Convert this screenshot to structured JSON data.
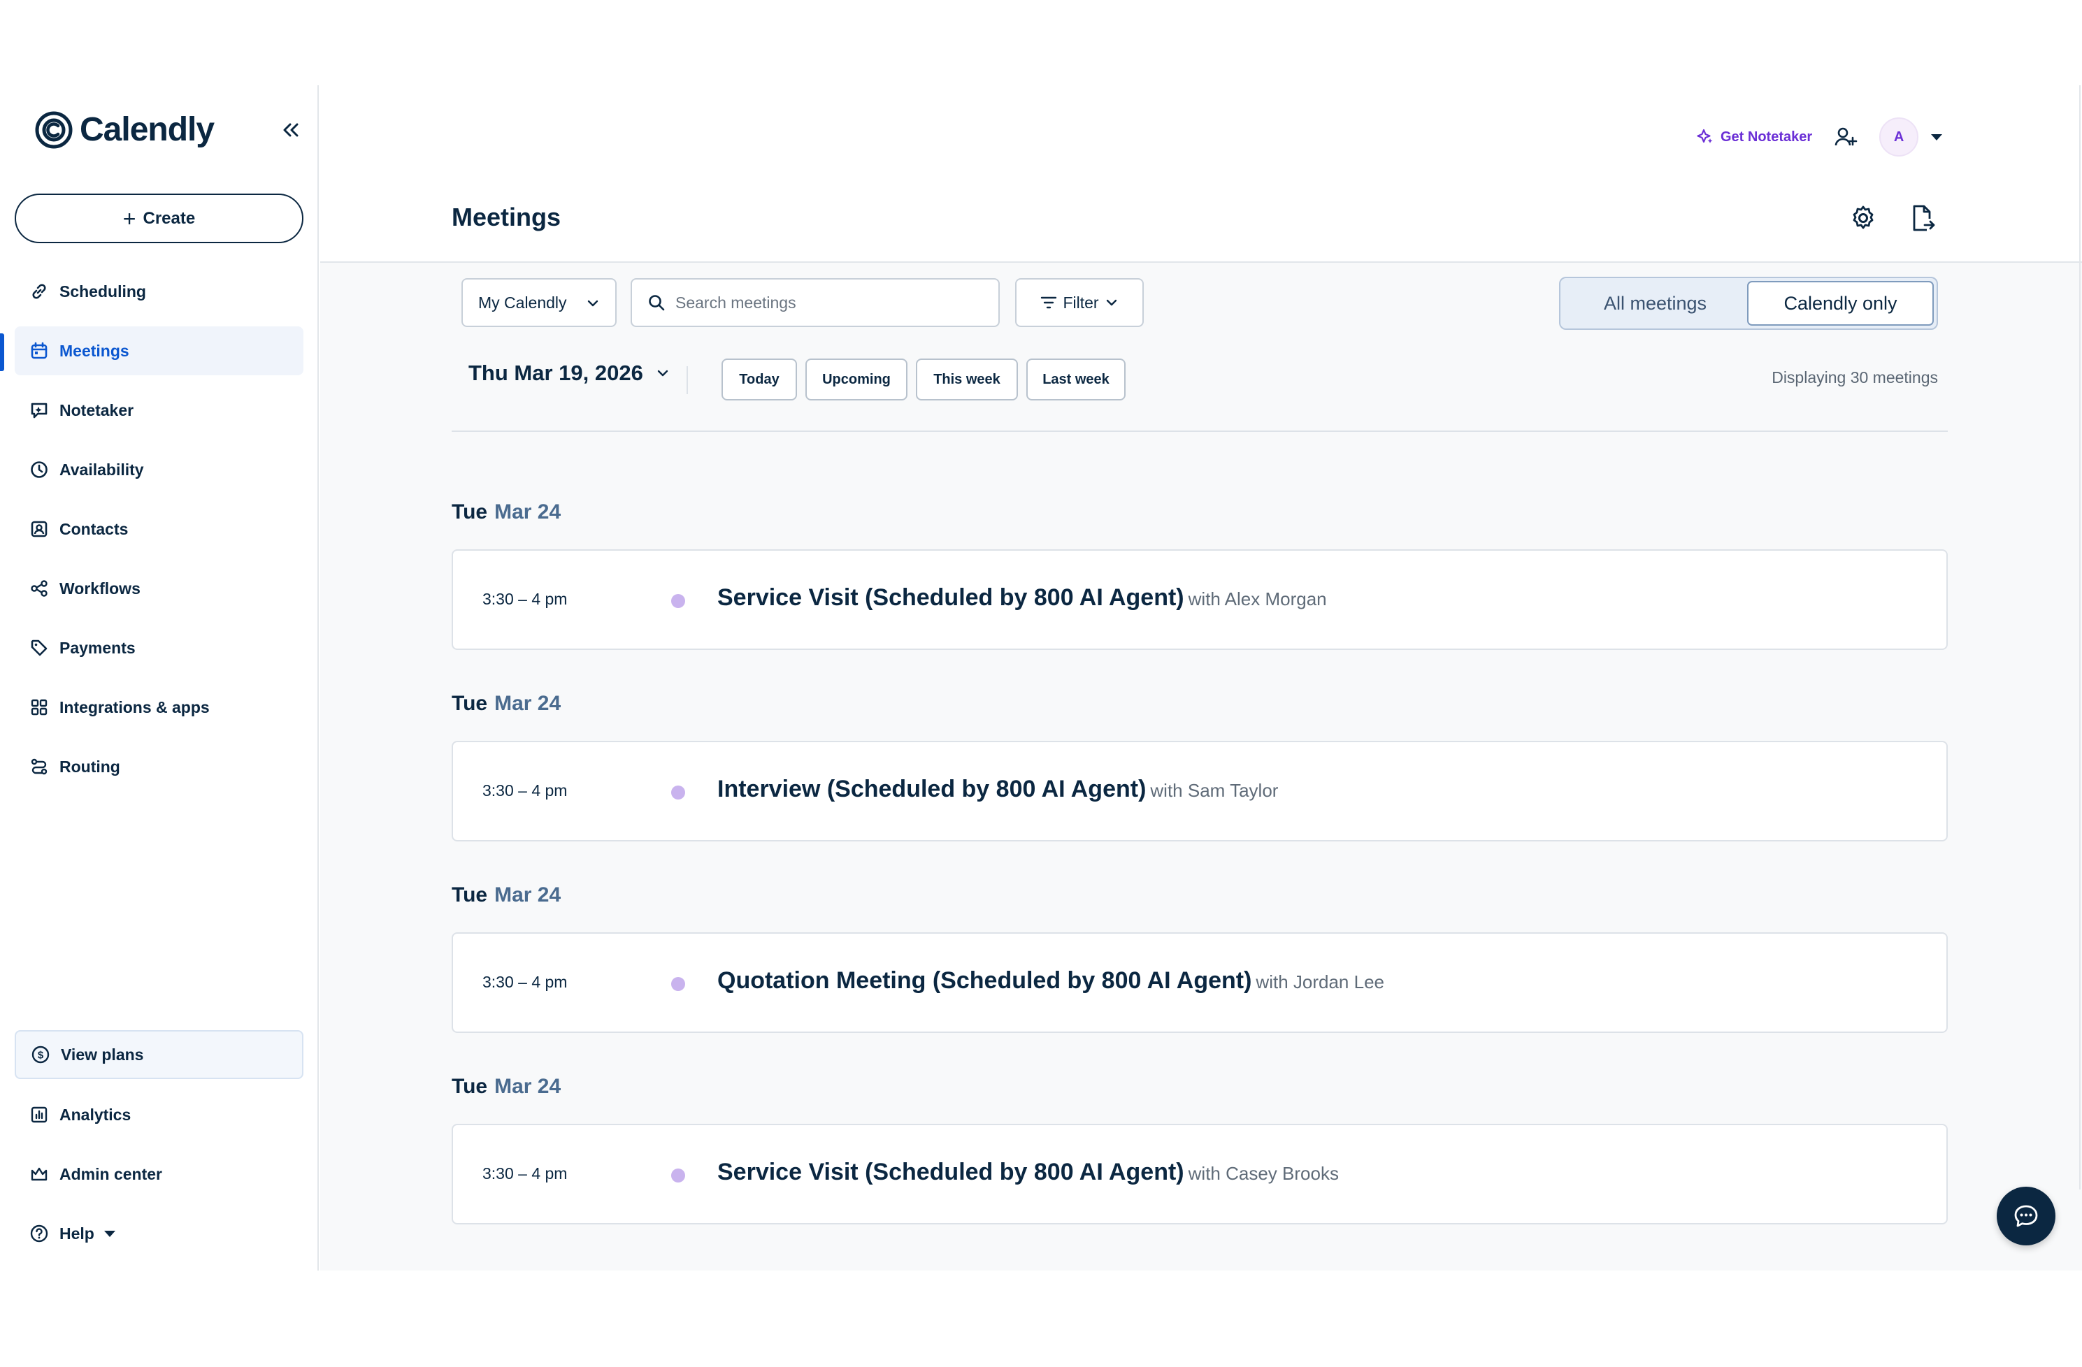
{
  "brand": {
    "name": "Calendly"
  },
  "sidebar": {
    "create_label": "Create",
    "items": [
      {
        "label": "Scheduling",
        "icon": "link-icon"
      },
      {
        "label": "Meetings",
        "icon": "calendar-icon"
      },
      {
        "label": "Notetaker",
        "icon": "notetaker-icon"
      },
      {
        "label": "Availability",
        "icon": "clock-icon"
      },
      {
        "label": "Contacts",
        "icon": "contact-card-icon"
      },
      {
        "label": "Workflows",
        "icon": "workflow-icon"
      },
      {
        "label": "Payments",
        "icon": "tag-icon"
      },
      {
        "label": "Integrations & apps",
        "icon": "grid-icon"
      },
      {
        "label": "Routing",
        "icon": "routing-icon"
      }
    ],
    "active_item": "Meetings",
    "view_plans_label": "View plans",
    "bottom_items": [
      {
        "label": "Analytics",
        "icon": "bar-chart-icon"
      },
      {
        "label": "Admin center",
        "icon": "crown-icon"
      },
      {
        "label": "Help",
        "icon": "help-icon"
      }
    ]
  },
  "header": {
    "notetaker_label": "Get Notetaker",
    "avatar_initial": "A",
    "page_title": "Meetings"
  },
  "toolbar": {
    "calendar_select": "My Calendly",
    "search_placeholder": "Search meetings",
    "filter_label": "Filter",
    "segments": [
      "All meetings",
      "Calendly only"
    ],
    "selected_segment": "Calendly only",
    "date": "Thu Mar 19, 2026",
    "quick_ranges": [
      "Today",
      "Upcoming",
      "This week",
      "Last week"
    ],
    "count_text": "Displaying 30 meetings"
  },
  "meetings": [
    {
      "day": "Tue",
      "date": "Mar 24",
      "time": "3:30 – 4 pm",
      "title": "Service Visit (Scheduled by 800 AI Agent)",
      "with": "with Alex Morgan"
    },
    {
      "day": "Tue",
      "date": "Mar 24",
      "time": "3:30 – 4 pm",
      "title": "Interview (Scheduled by 800 AI Agent)",
      "with": "with Sam Taylor"
    },
    {
      "day": "Tue",
      "date": "Mar 24",
      "time": "3:30 – 4 pm",
      "title": "Quotation Meeting (Scheduled by 800 AI Agent)",
      "with": "with Jordan Lee"
    },
    {
      "day": "Tue",
      "date": "Mar 24",
      "time": "3:30 – 4 pm",
      "title": "Service Visit (Scheduled by 800 AI Agent)",
      "with": "with Casey Brooks"
    }
  ],
  "colors": {
    "accent": "#0b57d0",
    "navy": "#0b2741",
    "purple": "#6b2fd6",
    "event_dot": "#c9b3ee"
  }
}
